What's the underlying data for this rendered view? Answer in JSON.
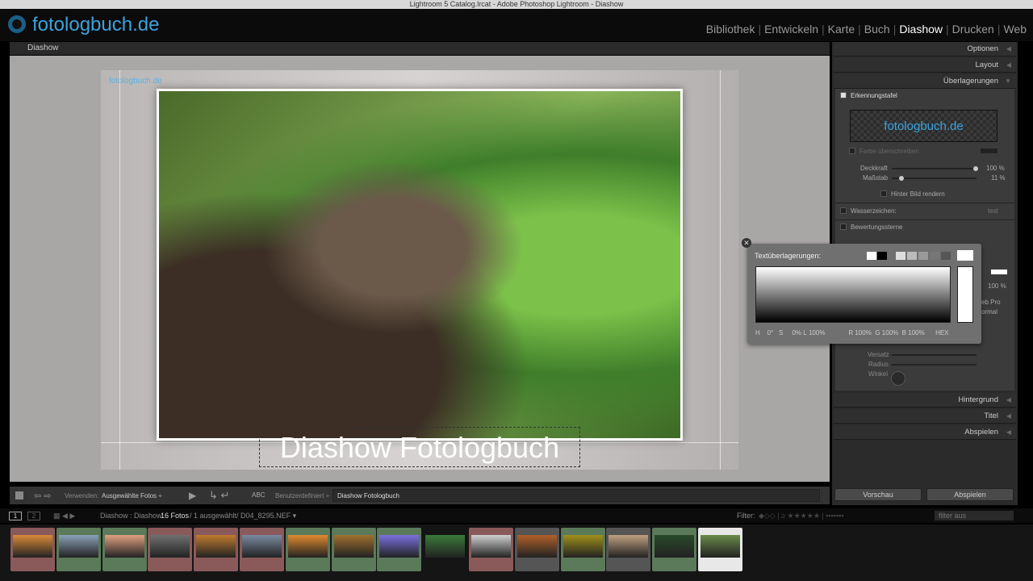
{
  "window": {
    "title": "Lightroom 5 Catalog.lrcat - Adobe Photoshop Lightroom - Diashow"
  },
  "brand": {
    "logo_text": "fotologbuch.de"
  },
  "modules": [
    "Bibliothek",
    "Entwickeln",
    "Karte",
    "Buch",
    "Diashow",
    "Drucken",
    "Web"
  ],
  "active_module": "Diashow",
  "left": {
    "header": "Diashow"
  },
  "slide": {
    "watermark_logo": "fotologbuch.de",
    "caption": "Diashow Fotologbuch"
  },
  "right": {
    "sections": {
      "optionen": "Optionen",
      "layout": "Layout",
      "ueberlagerungen": "Überlagerungen",
      "hintergrund": "Hintergrund",
      "titel": "Titel",
      "abspielen": "Abspielen"
    },
    "erkennungstafel": "Erkennungstafel",
    "identity_plate": "fotologbuch.de",
    "farbe": "Farbe überschreiben",
    "deckkraft": {
      "label": "Deckkraft",
      "value": "100 %",
      "fraction": 1.0
    },
    "massstab": {
      "label": "Maßstab",
      "value": "11 %",
      "fraction": 0.11
    },
    "hinter_bild": "Hinter Bild rendern",
    "wasserzeichen": {
      "label": "Wasserzeichen:",
      "value": "test"
    },
    "bewertungssterne": "Bewertungssterne",
    "text_opacity": "100 %",
    "font": "eb Pro",
    "style": "ormal",
    "versatz": "Versatz",
    "radius": "Radius",
    "winkel": "Winkel"
  },
  "colorpicker": {
    "title": "Textüberlagerungen:",
    "H": "0",
    "S": "0",
    "L": "100",
    "R": "100",
    "G": "100",
    "B": "100",
    "h_label": "H",
    "s_label": "S",
    "l_label": "L",
    "r_label": "R",
    "g_label": "G",
    "b_label": "B",
    "hex_label": "HEX",
    "pct": "%"
  },
  "toolbar": {
    "verwenden_label": "Verwenden:",
    "verwenden_value": "Ausgewählte Fotos",
    "abc": "ABC",
    "text_mode": "Benutzerdefiniert",
    "text_value": "Diashow Fotologbuch"
  },
  "buttons": {
    "vorschau": "Vorschau",
    "abspielen": "Abspielen"
  },
  "filmbar": {
    "page1": "1",
    "page2": "2",
    "source": "Diashow : Diashow",
    "count": "16 Fotos",
    "selected": "/ 1 ausgewählt/ D04_8295.NEF ▾",
    "filter_label": "Filter:",
    "filter_value": "filter aus"
  },
  "thumbnails": [
    {
      "bg": "#8a5a5a",
      "img": "#d98a3a"
    },
    {
      "bg": "#5a7a5a",
      "img": "#8aa0b8"
    },
    {
      "bg": "#5a7a5a",
      "img": "#e0a080"
    },
    {
      "bg": "#8a5a5a",
      "img": "#707070"
    },
    {
      "bg": "#8a5a5a",
      "img": "#c07a30"
    },
    {
      "bg": "#8a5a5a",
      "img": "#7a8aa0"
    },
    {
      "bg": "#5a7a5a",
      "img": "#e08a30"
    },
    {
      "bg": "#5a7a5a",
      "img": "#a07030"
    },
    {
      "bg": "#5a7a5a",
      "img": "#7a70e0"
    },
    {
      "bg": "#151515",
      "img": "#3a7a3a"
    },
    {
      "bg": "#8a5a5a",
      "img": "#d0d0d0"
    },
    {
      "bg": "#555555",
      "img": "#b0602a"
    },
    {
      "bg": "#5a7a5a",
      "img": "#a0901a"
    },
    {
      "bg": "#555555",
      "img": "#c0a080"
    },
    {
      "bg": "#5a7a5a",
      "img": "#2a4a2a"
    },
    {
      "bg": "#e8e8e8",
      "img": "#6a8a4a"
    }
  ]
}
